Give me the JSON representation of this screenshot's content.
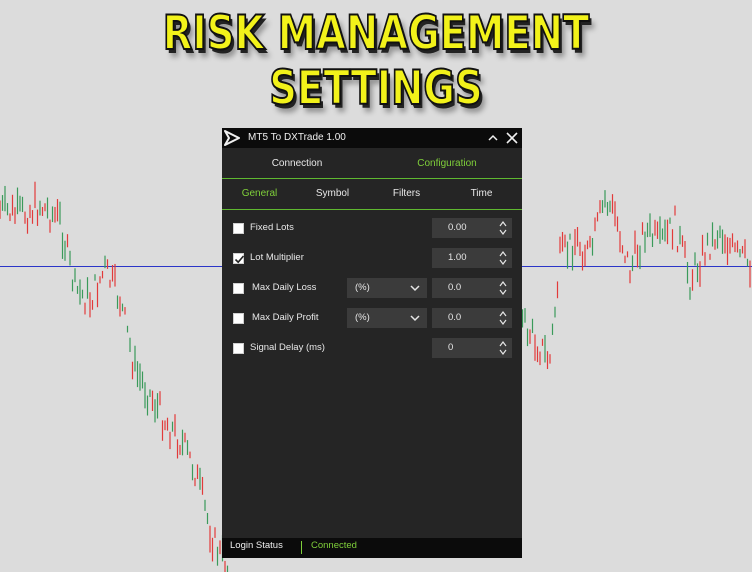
{
  "banner": {
    "title": "RISK MANAGEMENT SETTINGS"
  },
  "window": {
    "title": "MT5 To DXTrade 1.00"
  },
  "tabs": {
    "main": [
      {
        "label": "Connection",
        "active": false
      },
      {
        "label": "Configuration",
        "active": true
      }
    ],
    "sub": [
      {
        "label": "General",
        "active": true
      },
      {
        "label": "Symbol",
        "active": false
      },
      {
        "label": "Filters",
        "active": false
      },
      {
        "label": "Time",
        "active": false
      }
    ]
  },
  "general": {
    "fixed_lots": {
      "label": "Fixed Lots",
      "checked": false,
      "value": "0.00"
    },
    "lot_multiplier": {
      "label": "Lot Multiplier",
      "checked": true,
      "value": "1.00"
    },
    "max_daily_loss": {
      "label": "Max Daily Loss",
      "checked": false,
      "mode": "(%)",
      "value": "0.0"
    },
    "max_daily_profit": {
      "label": "Max Daily Profit",
      "checked": false,
      "mode": "(%)",
      "value": "0.0"
    },
    "signal_delay": {
      "label": "Signal Delay (ms)",
      "checked": false,
      "value": "0"
    }
  },
  "status": {
    "label": "Login Status",
    "value": "Connected"
  },
  "colors": {
    "accent": "#7fcf3a",
    "panel_bg": "#252525",
    "titlebar_bg": "#0b0b0b",
    "field_bg": "#3b3b3b",
    "banner_text": "#f2f21a",
    "candle_up": "#3a9a5a",
    "candle_down": "#e23a3a",
    "price_line": "#2b35c8"
  },
  "icons": {
    "app_logo": "arrow-play-logo-icon",
    "collapse": "chevron-up-icon",
    "close": "close-icon",
    "checkbox_check": "checkmark-icon",
    "dropdown": "chevron-down-icon",
    "spin_up": "triangle-up-icon",
    "spin_down": "triangle-down-icon"
  }
}
